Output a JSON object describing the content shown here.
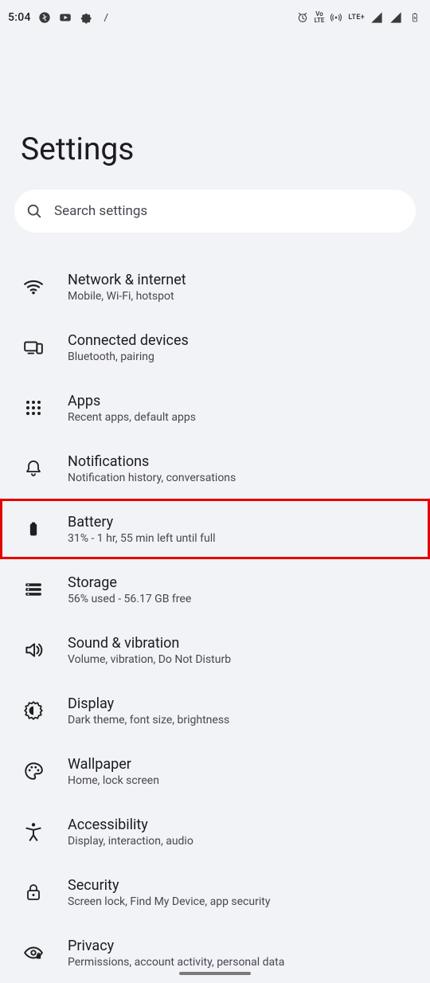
{
  "status_bar": {
    "time": "5:04",
    "lte_small_top": "Vo",
    "lte_small_bottom": "LTE",
    "lte_plus": "LTE+"
  },
  "header": {
    "title": "Settings"
  },
  "search": {
    "placeholder": "Search settings"
  },
  "items": [
    {
      "title": "Network & internet",
      "sub": "Mobile, Wi-Fi, hotspot"
    },
    {
      "title": "Connected devices",
      "sub": "Bluetooth, pairing"
    },
    {
      "title": "Apps",
      "sub": "Recent apps, default apps"
    },
    {
      "title": "Notifications",
      "sub": "Notification history, conversations"
    },
    {
      "title": "Battery",
      "sub": "31% - 1 hr, 55 min left until full"
    },
    {
      "title": "Storage",
      "sub": "56% used - 56.17 GB free"
    },
    {
      "title": "Sound & vibration",
      "sub": "Volume, vibration, Do Not Disturb"
    },
    {
      "title": "Display",
      "sub": "Dark theme, font size, brightness"
    },
    {
      "title": "Wallpaper",
      "sub": "Home, lock screen"
    },
    {
      "title": "Accessibility",
      "sub": "Display, interaction, audio"
    },
    {
      "title": "Security",
      "sub": "Screen lock, Find My Device, app security"
    },
    {
      "title": "Privacy",
      "sub": "Permissions, account activity, personal data"
    }
  ],
  "highlight_index": 4
}
